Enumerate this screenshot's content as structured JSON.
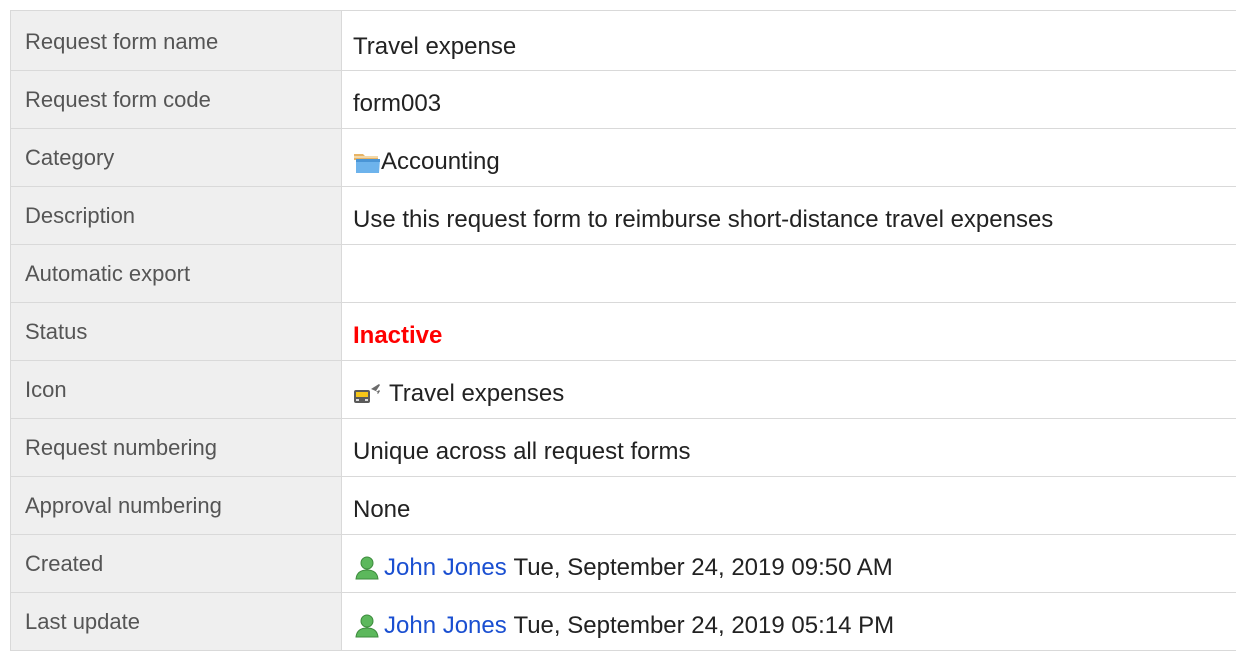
{
  "rows": [
    {
      "label": "Request form name",
      "value": "Travel expense"
    },
    {
      "label": "Request form code",
      "value": "form003"
    },
    {
      "label": "Category",
      "value": "Accounting",
      "icon": "folder-icon"
    },
    {
      "label": "Description",
      "value": "Use this request form to reimburse short-distance travel expenses"
    },
    {
      "label": "Automatic export",
      "value": ""
    },
    {
      "label": "Status",
      "value": "Inactive",
      "status_color": "#ff0000"
    },
    {
      "label": "Icon",
      "value": "Travel expenses",
      "icon": "train-airplane-icon"
    },
    {
      "label": "Request numbering",
      "value": "Unique across all request forms"
    },
    {
      "label": "Approval numbering",
      "value": "None"
    },
    {
      "label": "Created",
      "user": "John Jones",
      "datetime": "Tue, September 24, 2019 09:50 AM",
      "icon": "user-icon"
    },
    {
      "label": "Last update",
      "user": "John Jones",
      "datetime": "Tue, September 24, 2019 05:14 PM",
      "icon": "user-icon"
    }
  ],
  "colors": {
    "label_bg": "#efefef",
    "border": "#d9d9d9",
    "link": "#1a4fd1",
    "status_inactive": "#ff0000"
  }
}
